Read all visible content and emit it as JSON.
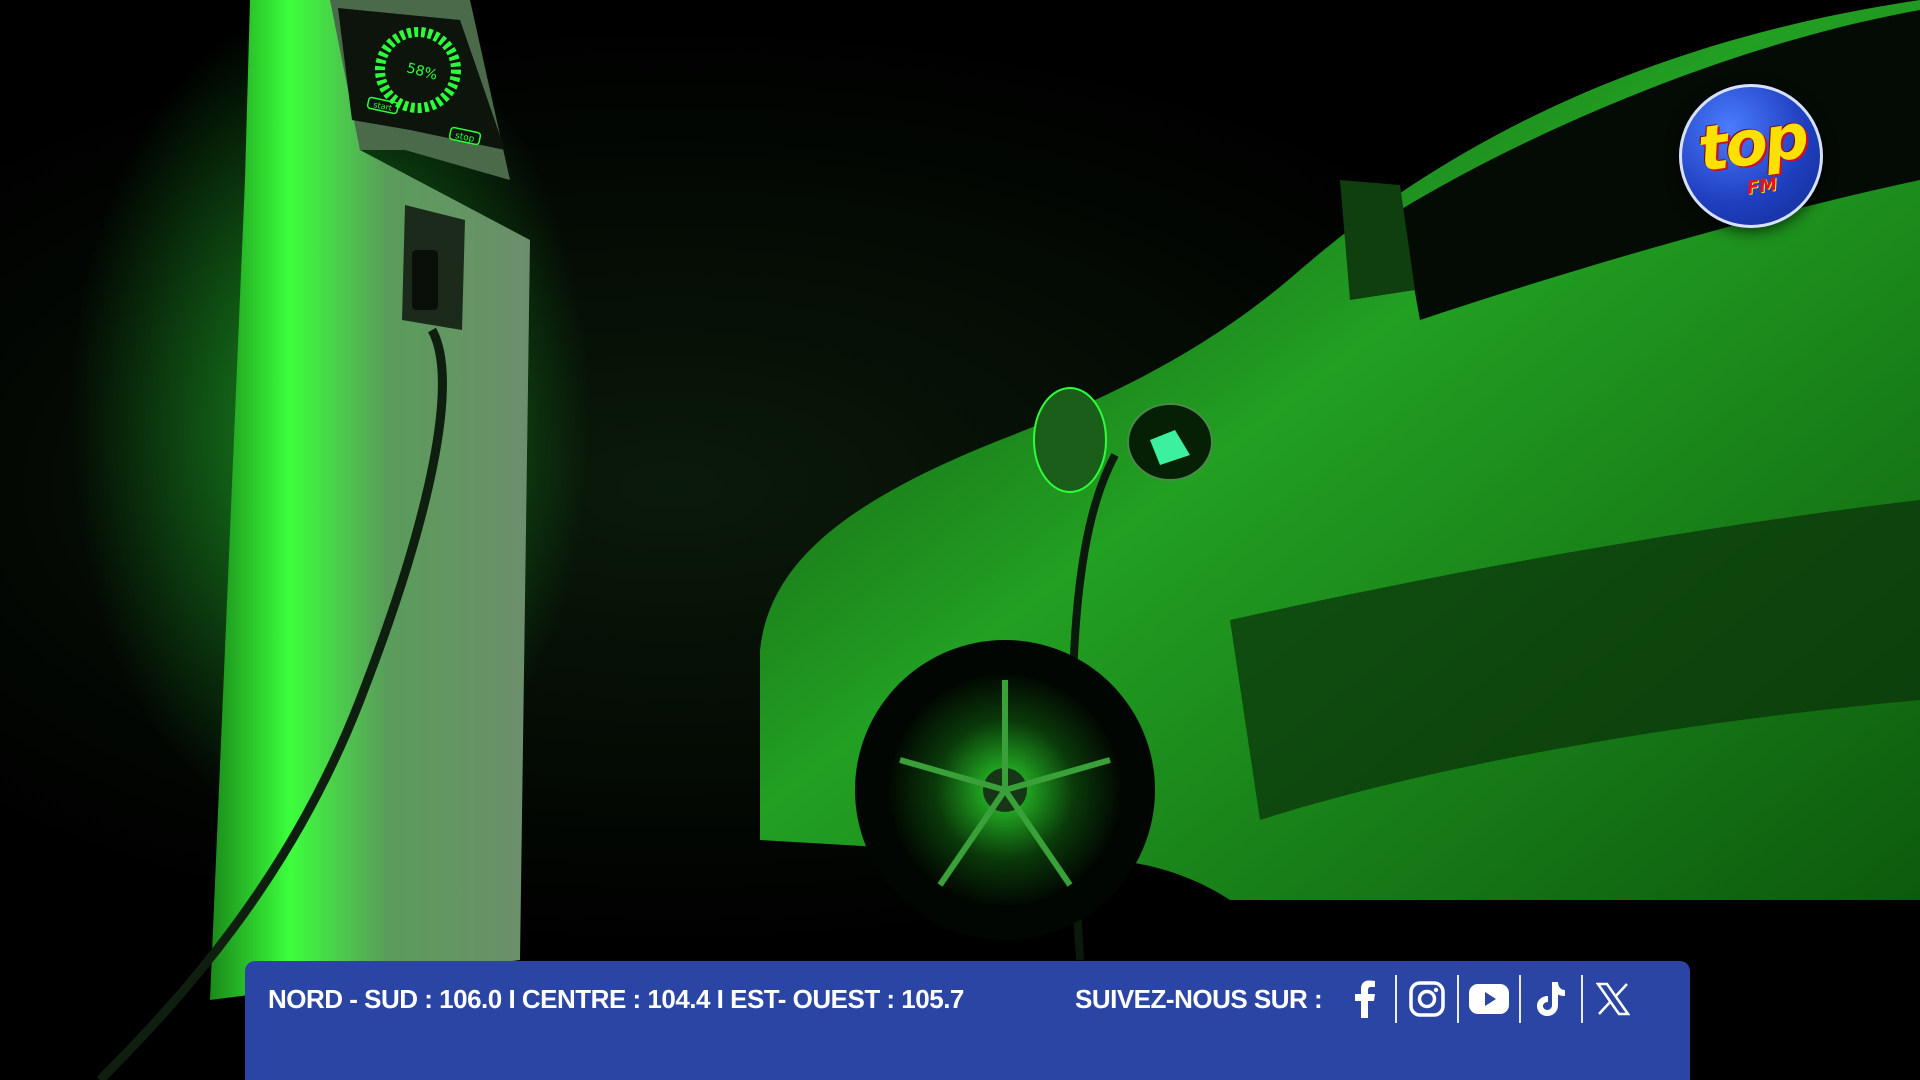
{
  "scene": {
    "description_icon": "ev-charging-photo",
    "charger_display_percent": "58%",
    "charger_start_label": "start",
    "charger_stop_label": "stop",
    "accent_color": "#2cff3a"
  },
  "logo": {
    "main": "top",
    "sub": "FM"
  },
  "banner": {
    "frequencies": "NORD - SUD : 106.0  I  CENTRE : 104.4  I  EST- OUEST : 105.7",
    "follow_label": "SUIVEZ-NOUS SUR :",
    "background_color": "#2a45a3",
    "socials": [
      {
        "icon": "facebook-icon"
      },
      {
        "icon": "instagram-icon"
      },
      {
        "icon": "youtube-icon"
      },
      {
        "icon": "tiktok-icon"
      },
      {
        "icon": "x-icon"
      }
    ]
  }
}
